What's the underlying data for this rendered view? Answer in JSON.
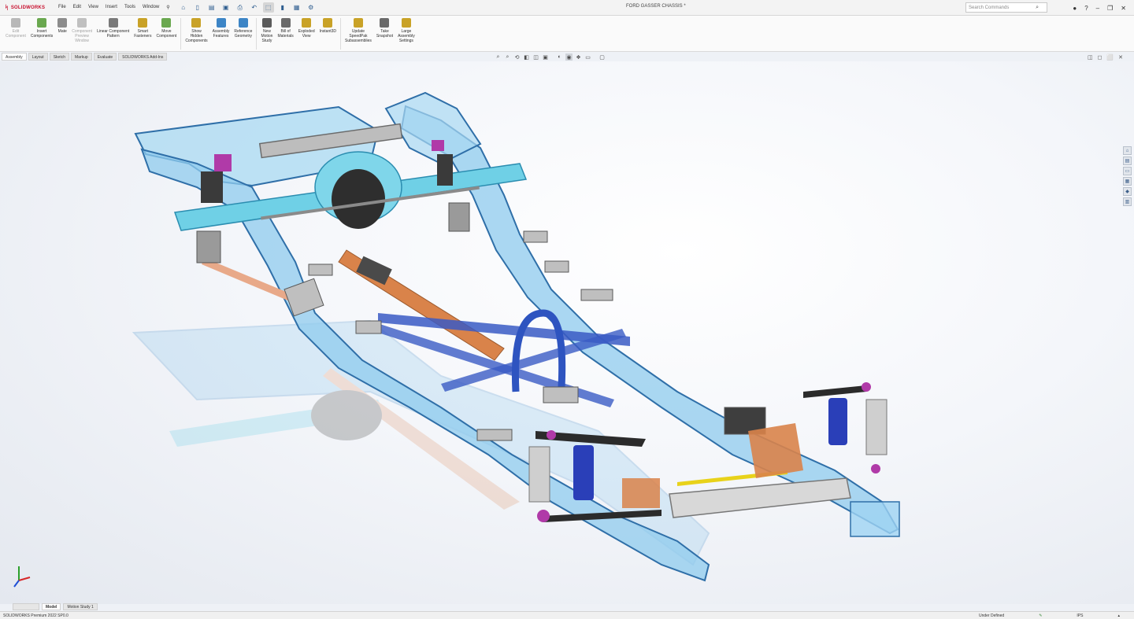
{
  "app": {
    "brand": "SOLIDWORKS",
    "menu": [
      "File",
      "Edit",
      "View",
      "Insert",
      "Tools",
      "Window"
    ],
    "document_title": "FORD GASSER CHASSIS *",
    "search_placeholder": "Search Commands"
  },
  "ribbon": {
    "buttons": [
      {
        "label": "Edit\nComponent",
        "icon": "edit-component-icon",
        "disabled": true,
        "color": "#b8b8b8"
      },
      {
        "label": "Insert\nComponents",
        "icon": "insert-components-icon",
        "disabled": false,
        "color": "#6aa84f"
      },
      {
        "label": "Mate",
        "icon": "mate-icon",
        "disabled": false,
        "color": "#8c8c8c"
      },
      {
        "label": "Component\nPreview\nWindow",
        "icon": "preview-window-icon",
        "disabled": true,
        "color": "#c0c0c0"
      },
      {
        "label": "Linear Component\nPattern",
        "icon": "linear-pattern-icon",
        "disabled": false,
        "color": "#7a7a7a"
      },
      {
        "label": "Smart\nFasteners",
        "icon": "smart-fasteners-icon",
        "disabled": false,
        "color": "#c9a227"
      },
      {
        "label": "Move\nComponent",
        "icon": "move-component-icon",
        "disabled": false,
        "color": "#6aa84f"
      },
      {
        "label": "Show\nHidden\nComponents",
        "icon": "show-hidden-icon",
        "disabled": false,
        "color": "#c9a227"
      },
      {
        "label": "Assembly\nFeatures",
        "icon": "assembly-features-icon",
        "disabled": false,
        "color": "#3d85c6"
      },
      {
        "label": "Reference\nGeometry",
        "icon": "reference-geometry-icon",
        "disabled": false,
        "color": "#3d85c6"
      },
      {
        "label": "New\nMotion\nStudy",
        "icon": "motion-study-icon",
        "disabled": false,
        "color": "#5b5b5b"
      },
      {
        "label": "Bill of\nMaterials",
        "icon": "bom-icon",
        "disabled": false,
        "color": "#6a6a6a"
      },
      {
        "label": "Exploded\nView",
        "icon": "exploded-view-icon",
        "disabled": false,
        "color": "#c9a227"
      },
      {
        "label": "Instant3D",
        "icon": "instant3d-icon",
        "disabled": false,
        "color": "#c9a227"
      },
      {
        "label": "Update\nSpeedPak\nSubassemblies",
        "icon": "speedpak-icon",
        "disabled": false,
        "color": "#c9a227"
      },
      {
        "label": "Take\nSnapshot",
        "icon": "snapshot-icon",
        "disabled": false,
        "color": "#6a6a6a"
      },
      {
        "label": "Large\nAssembly\nSettings",
        "icon": "large-assembly-icon",
        "disabled": false,
        "color": "#c9a227"
      }
    ]
  },
  "tabs": [
    "Assembly",
    "Layout",
    "Sketch",
    "Markup",
    "Evaluate",
    "SOLIDWORKS Add-Ins"
  ],
  "bottom_tabs": [
    "",
    "Model",
    "Motion Study 1"
  ],
  "status": {
    "left": "SOLIDWORKS Premium 2022 SP0.0",
    "mode": "Under Defined",
    "units": "IPS"
  },
  "colors": {
    "frame": "#7fc4ea",
    "frame_edge": "#2f6fa8",
    "axle": "#6fd0e6",
    "steel": "#7a7a7a",
    "copper": "#d9834a",
    "spring": "#2a3fb8",
    "accent": "#b03aa8"
  }
}
